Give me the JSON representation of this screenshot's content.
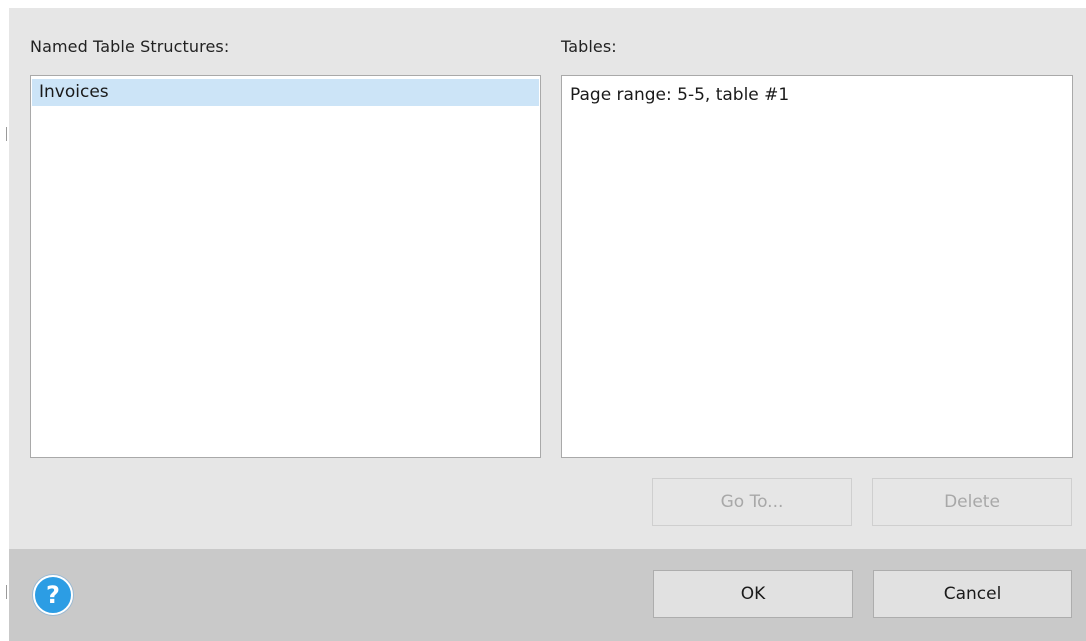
{
  "left_panel": {
    "label": "Named Table Structures:",
    "items": [
      {
        "label": "Invoices",
        "selected": true
      }
    ]
  },
  "right_panel": {
    "label": "Tables:",
    "items": [
      {
        "label": "Page range:  5-5, table #1",
        "selected": false
      }
    ]
  },
  "buttons": {
    "goto": "Go To...",
    "delete": "Delete",
    "ok": "OK",
    "cancel": "Cancel",
    "help": "?"
  },
  "colors": {
    "dialog_bg": "#e6e6e6",
    "footer_bg": "#c9c9c9",
    "selection": "#cce4f7",
    "help_icon": "#2c9de4"
  },
  "icons": [
    "help-icon"
  ]
}
